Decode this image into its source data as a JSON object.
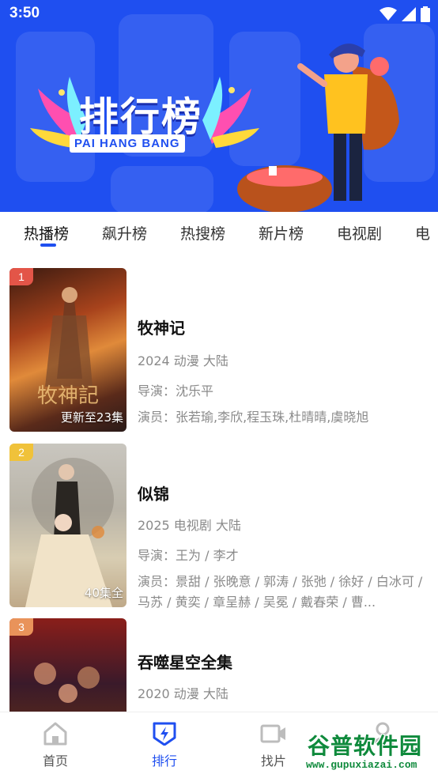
{
  "status": {
    "time": "3:50"
  },
  "banner": {
    "title": "排行榜",
    "subtitle": "PAI HANG BANG"
  },
  "tabs": [
    {
      "label": "热播榜",
      "active": true
    },
    {
      "label": "飙升榜",
      "active": false
    },
    {
      "label": "热搜榜",
      "active": false
    },
    {
      "label": "新片榜",
      "active": false
    },
    {
      "label": "电视剧",
      "active": false
    },
    {
      "label": "电",
      "active": false
    }
  ],
  "items": [
    {
      "rank": "1",
      "rank_color": "#e35548",
      "poster_badge": "更新至23集",
      "title": "牧神记",
      "meta": "2024 动漫 大陆",
      "director": "导演：沈乐平",
      "cast": "演员：张若瑜,李欣,程玉珠,杜晴晴,虞晓旭"
    },
    {
      "rank": "2",
      "rank_color": "#f0c23a",
      "poster_badge": "40集全",
      "title": "似锦",
      "meta": "2025 电视剧 大陆",
      "director": "导演：王为 / 李才",
      "cast": "演员：景甜 / 张晚意 / 郭涛 / 张弛 / 徐好 / 白冰可 / 马苏 / 黄奕 / 章呈赫 / 吴冕 / 戴春荣 / 曹..."
    },
    {
      "rank": "3",
      "rank_color": "#e9935a",
      "poster_badge": "",
      "title": "吞噬星空全集",
      "meta": "2020 动漫 大陆",
      "director": "",
      "cast": ""
    }
  ],
  "bottom_nav": [
    {
      "label": "首页",
      "icon": "home-icon",
      "active": false
    },
    {
      "label": "排行",
      "icon": "ranking-icon",
      "active": true
    },
    {
      "label": "找片",
      "icon": "video-camera-icon",
      "active": false
    },
    {
      "label": "",
      "icon": "profile-icon",
      "active": false
    }
  ],
  "watermark": {
    "text": "谷普软件园",
    "url": "www.gupuxiazai.com"
  },
  "colors": {
    "accent": "#1f4ff0"
  }
}
